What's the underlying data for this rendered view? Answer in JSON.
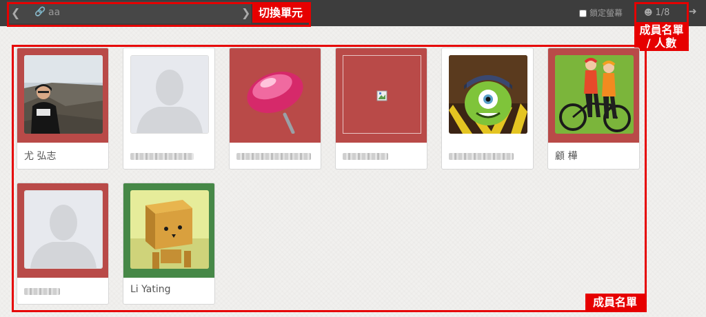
{
  "header": {
    "unit_name": "aa",
    "lock_label": "鎖定螢幕",
    "member_count": "1/8"
  },
  "annotations": {
    "switch_unit": "切換單元",
    "member_count_line1": "成員名單",
    "member_count_line2": "/ 人數",
    "member_list": "成員名單"
  },
  "members": [
    {
      "name": "尤 弘志",
      "frame": "red",
      "photo": "person-photo"
    },
    {
      "name": "",
      "frame": "white",
      "photo": "default-silhouette"
    },
    {
      "name": "",
      "frame": "red",
      "photo": "pink-pushpin"
    },
    {
      "name": "",
      "frame": "red",
      "photo": "broken-image"
    },
    {
      "name": "",
      "frame": "white",
      "photo": "one-eyed-monster"
    },
    {
      "name": "顧 樺",
      "frame": "red",
      "photo": "cyclists-cartoon"
    },
    {
      "name": "",
      "frame": "red",
      "photo": "default-silhouette"
    },
    {
      "name": "Li Yating",
      "frame": "green",
      "photo": "cardboard-robot"
    }
  ],
  "colors": {
    "topbar": "#3d3d3d",
    "card_red": "#b94a48",
    "card_green": "#468847",
    "annotation_red": "#e60000"
  }
}
